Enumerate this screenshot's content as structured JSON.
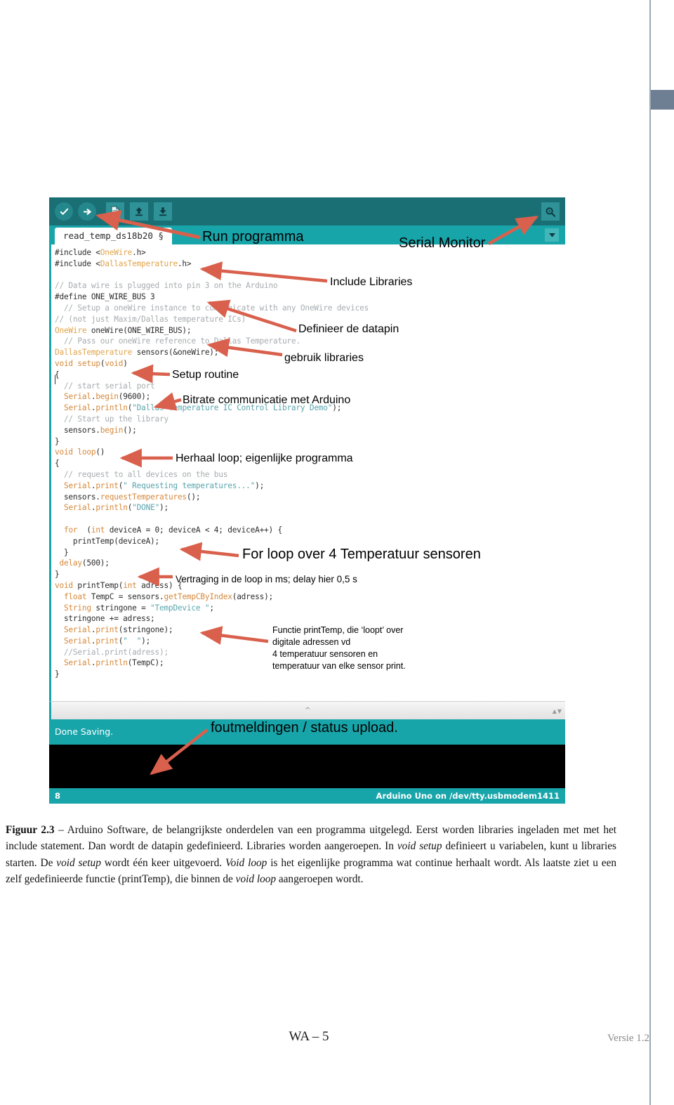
{
  "page": {
    "footer_page": "WA – 5",
    "footer_version": "Versie 1.2"
  },
  "ide": {
    "toolbar": {
      "verify_label": "verify-icon",
      "upload_label": "upload-icon",
      "new_label": "new-icon",
      "open_label": "open-icon",
      "save_label": "save-icon",
      "serial_monitor_label": "serial-monitor-icon"
    },
    "tab": {
      "sketch_name": "read_temp_ds18b20 §",
      "dropdown_label": "▼"
    },
    "status": {
      "message": "Done Saving.",
      "line_number": "8",
      "board_info": "Arduino Uno on /dev/tty.usbmodem1411"
    },
    "split": {
      "handle_glyph": "^",
      "arrows_glyph": "▲▼"
    },
    "code_lines": [
      "#include <OneWire.h>",
      "#include <DallasTemperature.h>",
      "",
      "// Data wire is plugged into pin 3 on the Arduino",
      "#define ONE_WIRE_BUS 3",
      "  // Setup a oneWire instance to communicate with any OneWire devices",
      "// (not just Maxim/Dallas temperature ICs)",
      "OneWire oneWire(ONE_WIRE_BUS);",
      "  // Pass our oneWire reference to Dallas Temperature.",
      "DallasTemperature sensors(&oneWire);",
      "void setup(void)",
      "{",
      "  // start serial port",
      "  Serial.begin(9600);",
      "  Serial.println(\"Dallas Temperature IC Control Library Demo\");",
      "  // Start up the library",
      "  sensors.begin();",
      "}",
      "void loop()",
      "{",
      "  // request to all devices on the bus",
      "  Serial.print(\" Requesting temperatures...\");",
      "  sensors.requestTemperatures();",
      "  Serial.println(\"DONE\");",
      "",
      "  for  (int deviceA = 0; deviceA < 4; deviceA++) {",
      "    printTemp(deviceA);",
      "  }",
      " delay(500);",
      "}",
      "void printTemp(int adress) {",
      "  float TempC = sensors.getTempCByIndex(adress);",
      "  String stringone = \"TempDevice \";",
      "  stringone += adress;",
      "  Serial.print(stringone);",
      "  Serial.print(\"  \");",
      "  //Serial.print(adress);",
      "  Serial.println(TempC);",
      "}"
    ]
  },
  "annotations": {
    "run_programma": "Run programma",
    "serial_monitor": "Serial Monitor",
    "include_libraries": "Include Libraries",
    "definieer_datapin": "Definieer de datapin",
    "gebruik_libraries": "gebruik libraries",
    "setup_routine": "Setup routine",
    "bitrate": "Bitrate communicatie met Arduino",
    "herhaal_loop": "Herhaal loop; eigenlijke programma",
    "for_loop": "For loop over 4 Temperatuur sensoren",
    "vertraging": "Vertraging in de loop in ms; delay hier 0,5 s",
    "printtemp_block": "Functie printTemp, die ‘loopt’ over\ndigitale adressen vd\n4 temperatuur sensoren en\ntemperatuur van elke sensor print.",
    "foutmeldingen": "foutmeldingen / status upload."
  },
  "caption": {
    "label": "Figuur 2.3",
    "dash": " – ",
    "text_1": "Arduino Software, de belangrijkste onderdelen van een programma uitgelegd. Eerst worden libraries ingeladen met met het include statement. Dan wordt de datapin gedefinieerd. Libraries worden aangeroepen. In ",
    "em_1": "void setup",
    "text_2": " definieert u variabelen, kunt u libraries starten. De ",
    "em_2": "void setup",
    "text_3": " wordt één keer uitgevoerd. ",
    "em_3": "Void loop",
    "text_4": " is het eigenlijke programma wat continue herhaalt wordt. Als laatste ziet u een zelf gedefinieerde functie (printTemp), die binnen de ",
    "em_4": "void loop",
    "text_5": " aangeroepen wordt."
  },
  "colors": {
    "ide_toolbar": "#1a6f74",
    "ide_teal": "#18a5aa",
    "arrow_red": "#d9604c",
    "console_black": "#000000",
    "page_rule": "#9aa8b5",
    "page_tab": "#6e7f94"
  }
}
